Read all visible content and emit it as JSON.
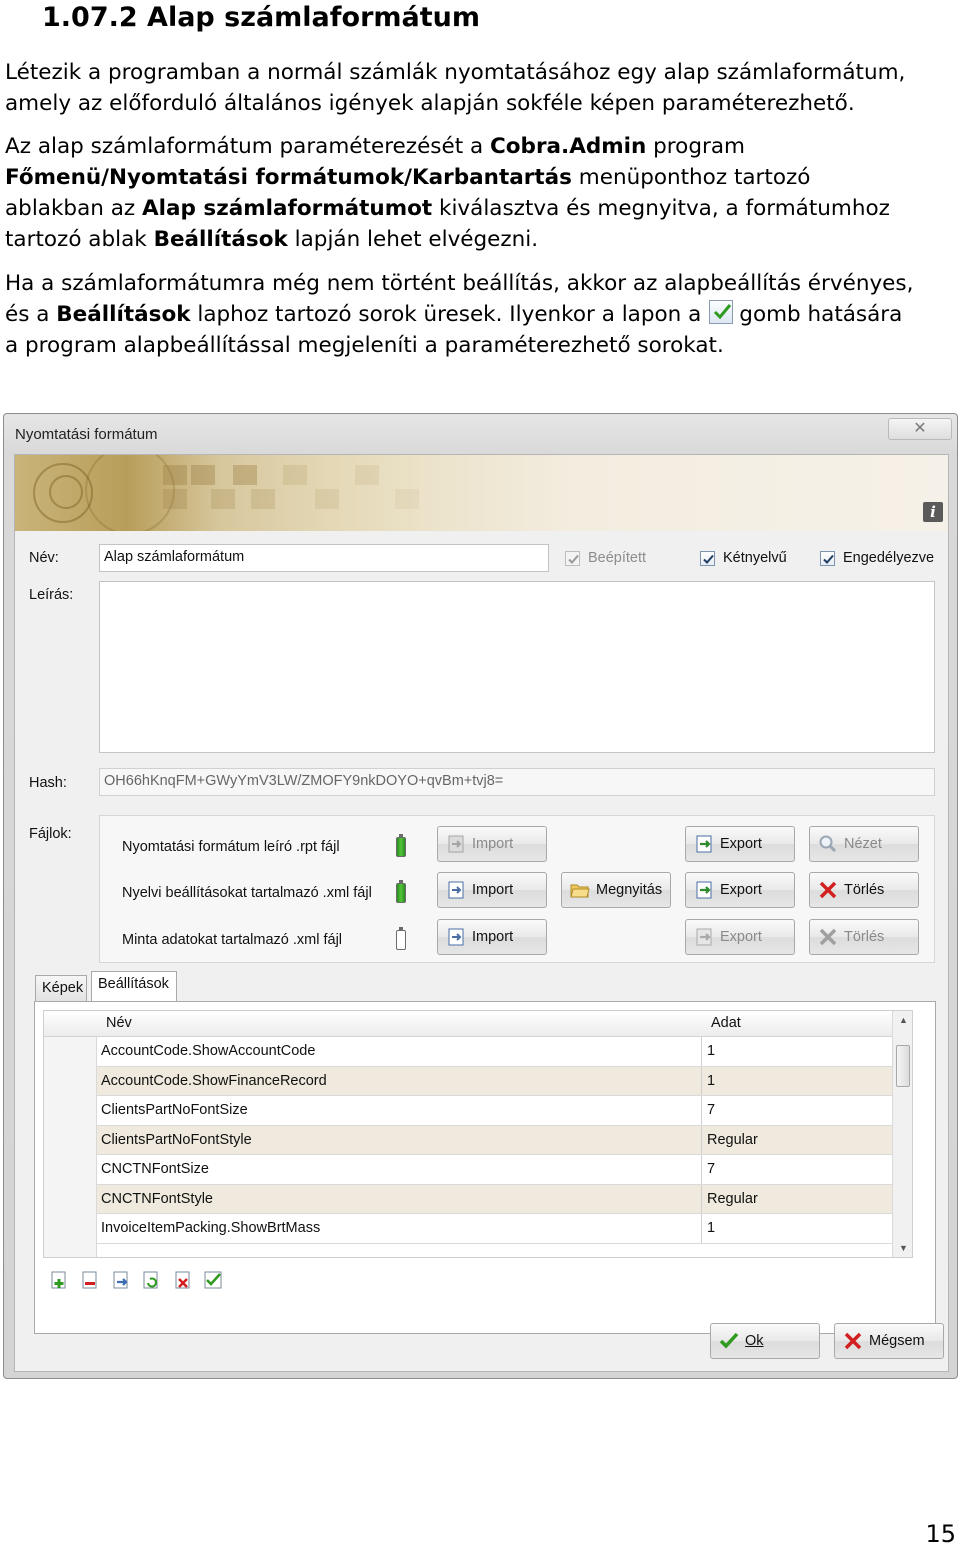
{
  "doc": {
    "heading": "1.07.2 Alap számlaformátum",
    "p1_line1": "Létezik a programban a normál számlák nyomtatásához egy alap számlaformátum,",
    "p1_line2": "amely az előforduló általános igények alapján sokféle képen paraméterezhető.",
    "p2_a": "Az alap számlaformátum paraméterezését a ",
    "p2_b_bold": "Cobra.Admin",
    "p2_c": " program",
    "p2_d_bold": "Főmenü/Nyomtatási formátumok/Karbantartás",
    "p2_e": " menüponthoz tartozó",
    "p2_f": "ablakban az ",
    "p2_g_bold": "Alap számlaformátumot",
    "p2_h": " kiválasztva és megnyitva, a formátumhoz",
    "p2_i": "tartozó ablak ",
    "p2_j_bold": "Beállítások",
    "p2_k": " lapján lehet elvégezni.",
    "p3_line1": "Ha a számlaformátumra még nem történt beállítás, akkor az alapbeállítás érvényes,",
    "p3_a": "és a ",
    "p3_b_bold": "Beállítások",
    "p3_c": " laphoz tartozó sorok üresek. Ilyenkor a lapon a",
    "p3_d": "gomb hatására",
    "p3_line3": "a program alapbeállítással megjeleníti a paraméterezhető sorokat.",
    "page_number": "15"
  },
  "dialog": {
    "title": "Nyomtatási formátum",
    "close": "✕",
    "labels": {
      "name": "Név:",
      "description": "Leírás:",
      "hash": "Hash:",
      "files": "Fájlok:"
    },
    "name_value": "Alap számlaformátum",
    "description_value": "",
    "hash_value": "OH66hKnqFM+GWyYmV3LW/ZMOFY9nkDOYO+qvBm+tvj8=",
    "checkboxes": [
      {
        "label": "Beépített",
        "checked": true,
        "disabled": true
      },
      {
        "label": "Kétnyelvű",
        "checked": true,
        "disabled": false
      },
      {
        "label": "Engedélyezve",
        "checked": true,
        "disabled": false
      }
    ],
    "file_rows": [
      {
        "label": "Nyomtatási formátum leíró .rpt fájl",
        "present": true,
        "import": "Import",
        "open": "",
        "export": "Export",
        "last": "Nézet"
      },
      {
        "label": "Nyelvi beállításokat tartalmazó .xml fájl",
        "present": true,
        "import": "Import",
        "open": "Megnyitás",
        "export": "Export",
        "last": "Törlés"
      },
      {
        "label": "Minta adatokat tartalmazó .xml fájl",
        "present": false,
        "import": "Import",
        "open": "",
        "export": "Export",
        "last": "Törlés"
      }
    ],
    "tabs": {
      "images": "Képek",
      "settings": "Beállítások"
    },
    "grid": {
      "col_name": "Név",
      "col_value": "Adat",
      "rows": [
        {
          "name": "AccountCode.ShowAccountCode",
          "value": "1"
        },
        {
          "name": "AccountCode.ShowFinanceRecord",
          "value": "1"
        },
        {
          "name": "ClientsPartNoFontSize",
          "value": "7"
        },
        {
          "name": "ClientsPartNoFontStyle",
          "value": "Regular"
        },
        {
          "name": "CNCTNFontSize",
          "value": "7"
        },
        {
          "name": "CNCTNFontStyle",
          "value": "Regular"
        },
        {
          "name": "InvoiceItemPacking.ShowBrtMass",
          "value": "1"
        }
      ]
    },
    "ok": "Ok",
    "cancel": "Mégsem"
  },
  "colors": {
    "alt_row": "#efeadd",
    "battery_green": "#53c63a",
    "delete_red": "#d21f1f"
  }
}
